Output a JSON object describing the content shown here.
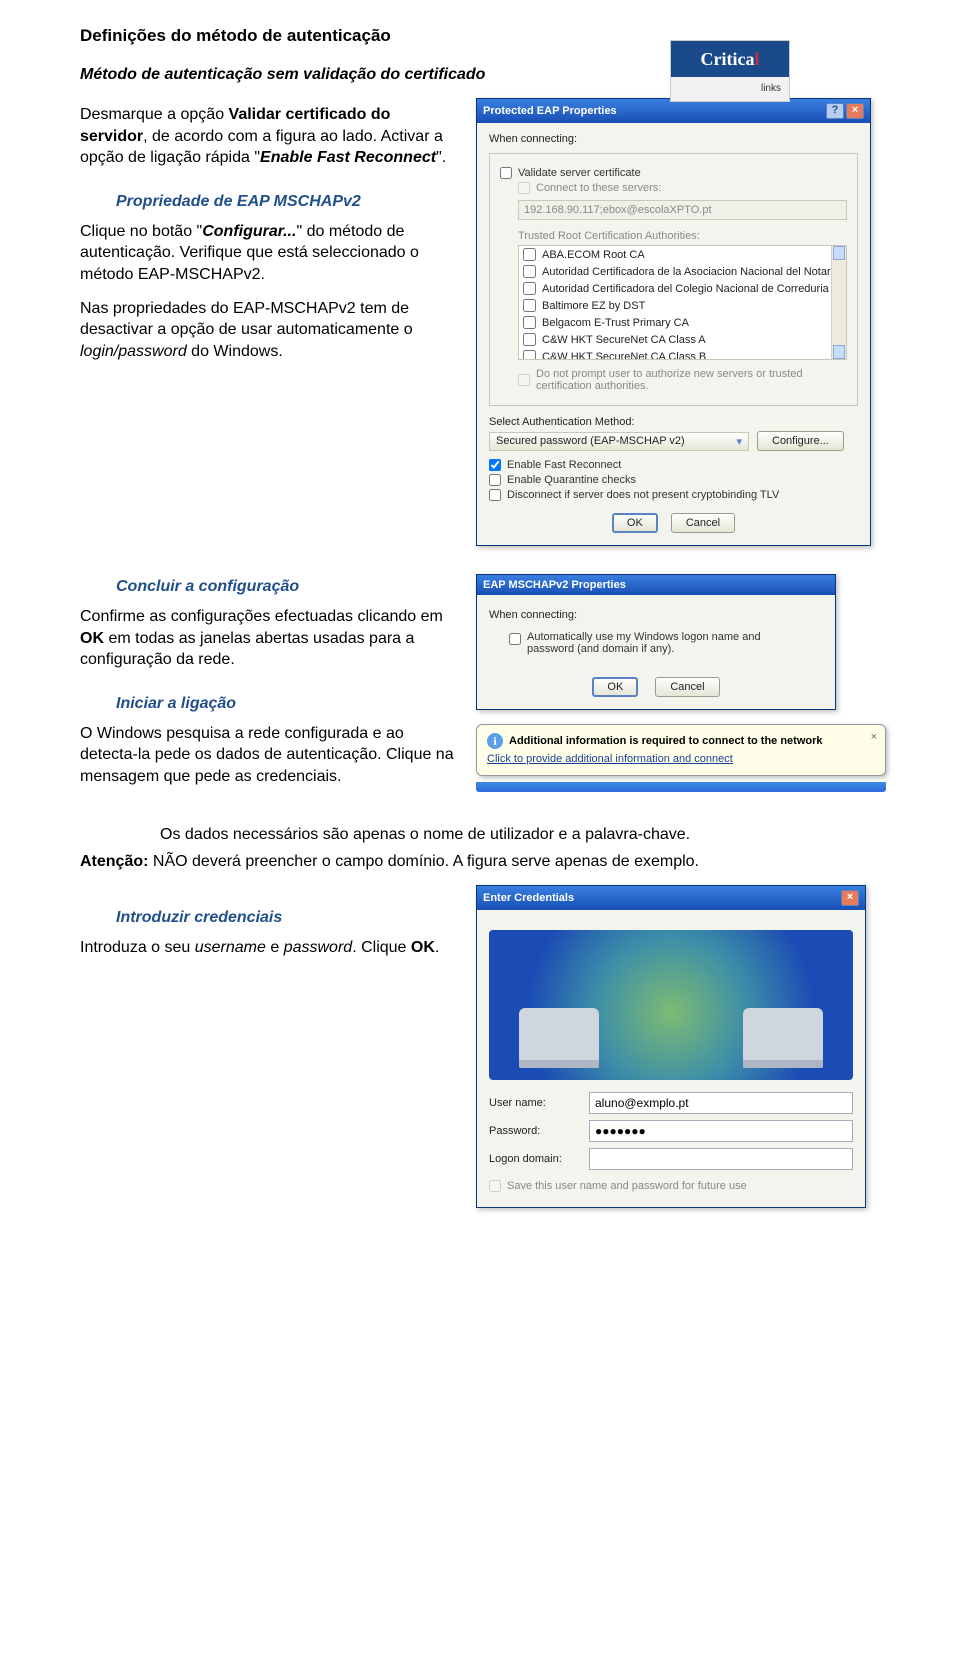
{
  "logo": {
    "word1": "Critica",
    "word1_accent": "l",
    "word2": "links"
  },
  "doc": {
    "title": "Definições do método de autenticação",
    "method_heading": "Método de autenticação sem validação do certificado",
    "p1_a": "Desmarque a opção ",
    "p1_b": "Validar certificado do servidor",
    "p1_c": ", de acordo com a figura ao lado. Activar a opção de ligação rápida \"",
    "p1_d": "Enable Fast Reconnect",
    "p1_e": "\".",
    "mschap_heading": "Propriedade de EAP MSCHAPv2",
    "p2_a": "Clique no botão \"",
    "p2_b": "Configurar...",
    "p2_c": "\" do método de autenticação. Verifique que está seleccionado o método EAP-MSCHAPv2.",
    "p3_a": "Nas propriedades do EAP-MSCHAPv2 tem de desactivar a opção de usar automaticamente o ",
    "p3_b": "login/password",
    "p3_c": " do Windows.",
    "concl_heading": "Concluir a configuração",
    "p4_a": "Confirme as configurações efectuadas clicando em ",
    "p4_b": "OK",
    "p4_c": " em todas as janelas abertas usadas para a configuração da rede.",
    "start_heading": "Iniciar a ligação",
    "p5": "O Windows pesquisa a rede configurada e ao detecta-la pede os dados de autenticação. Clique na mensagem que pede as credenciais.",
    "p6": "Os dados necessários são apenas o nome de utilizador e a palavra-chave.",
    "p7_a": "Atenção:",
    "p7_b": " NÃO deverá preencher o campo domínio. A figura serve apenas de exemplo.",
    "cred_heading": "Introduzir credenciais",
    "p8_a": "Introduza o seu ",
    "p8_b": "username",
    "p8_c": " e ",
    "p8_d": "password",
    "p8_e": ". Clique ",
    "p8_f": "OK",
    "p8_g": "."
  },
  "peap": {
    "title": "Protected EAP Properties",
    "when": "When connecting:",
    "validate": "Validate server certificate",
    "connect_servers": "Connect to these servers:",
    "servers_value": "192.168.90.117;ebox@escolaXPTO.pt",
    "trusted_heading": "Trusted Root Certification Authorities:",
    "cas": [
      "ABA.ECOM Root CA",
      "Autoridad Certificadora de la Asociacion Nacional del Notaria",
      "Autoridad Certificadora del Colegio Nacional de Correduria P",
      "Baltimore EZ by DST",
      "Belgacom E-Trust Primary CA",
      "C&W HKT SecureNet CA Class A",
      "C&W HKT SecureNet CA Class B"
    ],
    "noprompt": "Do not prompt user to authorize new servers or trusted certification authorities.",
    "sel_label": "Select Authentication Method:",
    "sel_value": "Secured password (EAP-MSCHAP v2)",
    "cfg_btn": "Configure...",
    "c1": "Enable Fast Reconnect",
    "c2": "Enable Quarantine checks",
    "c3": "Disconnect if server does not present cryptobinding TLV",
    "ok": "OK",
    "cancel": "Cancel"
  },
  "mschap": {
    "title": "EAP MSCHAPv2 Properties",
    "when": "When connecting:",
    "auto": "Automatically use my Windows logon name and password (and domain if any).",
    "ok": "OK",
    "cancel": "Cancel"
  },
  "balloon": {
    "title": "Additional information is required to connect to the network",
    "link": "Click to provide additional information and connect"
  },
  "cred": {
    "title": "Enter Credentials",
    "user_l": "User name:",
    "user_v": "aluno@exmplo.pt",
    "pass_l": "Password:",
    "pass_v": "●●●●●●●",
    "dom_l": "Logon domain:",
    "dom_v": "",
    "save": "Save this user name and password for future use"
  }
}
